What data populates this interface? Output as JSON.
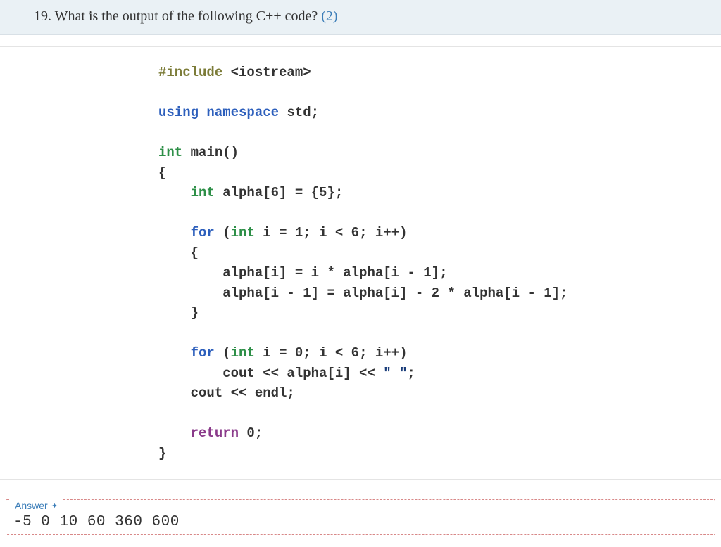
{
  "question": {
    "number": "19.",
    "text": "What is the output of the following C++ code?",
    "points": "(2)"
  },
  "code": {
    "line1_a": "#include",
    "line1_b": " <iostream>",
    "line2_a": "using",
    "line2_b": " namespace",
    "line2_c": " std;",
    "line3_a": "int",
    "line3_b": " main",
    "line3_c": "()",
    "line4": "{",
    "line5_a": "    int",
    "line5_b": " alpha[6] = {5};",
    "line6_a": "    for",
    "line6_b": " (",
    "line6_c": "int",
    "line6_d": " i = 1; i < 6; i++)",
    "line7": "    {",
    "line8": "        alpha[i] = i * alpha[i - 1];",
    "line9": "        alpha[i - 1] = alpha[i] - 2 * alpha[i - 1];",
    "line10": "    }",
    "line11_a": "    for",
    "line11_b": " (",
    "line11_c": "int",
    "line11_d": " i = 0; i < 6; i++)",
    "line12_a": "        cout << alpha[i] << ",
    "line12_b": "\" \"",
    "line12_c": ";",
    "line13": "    cout << endl;",
    "line14_a": "    return",
    "line14_b": " 0;",
    "line15": "}"
  },
  "answer": {
    "label": "Answer",
    "text": "-5 0 10 60 360 600"
  }
}
